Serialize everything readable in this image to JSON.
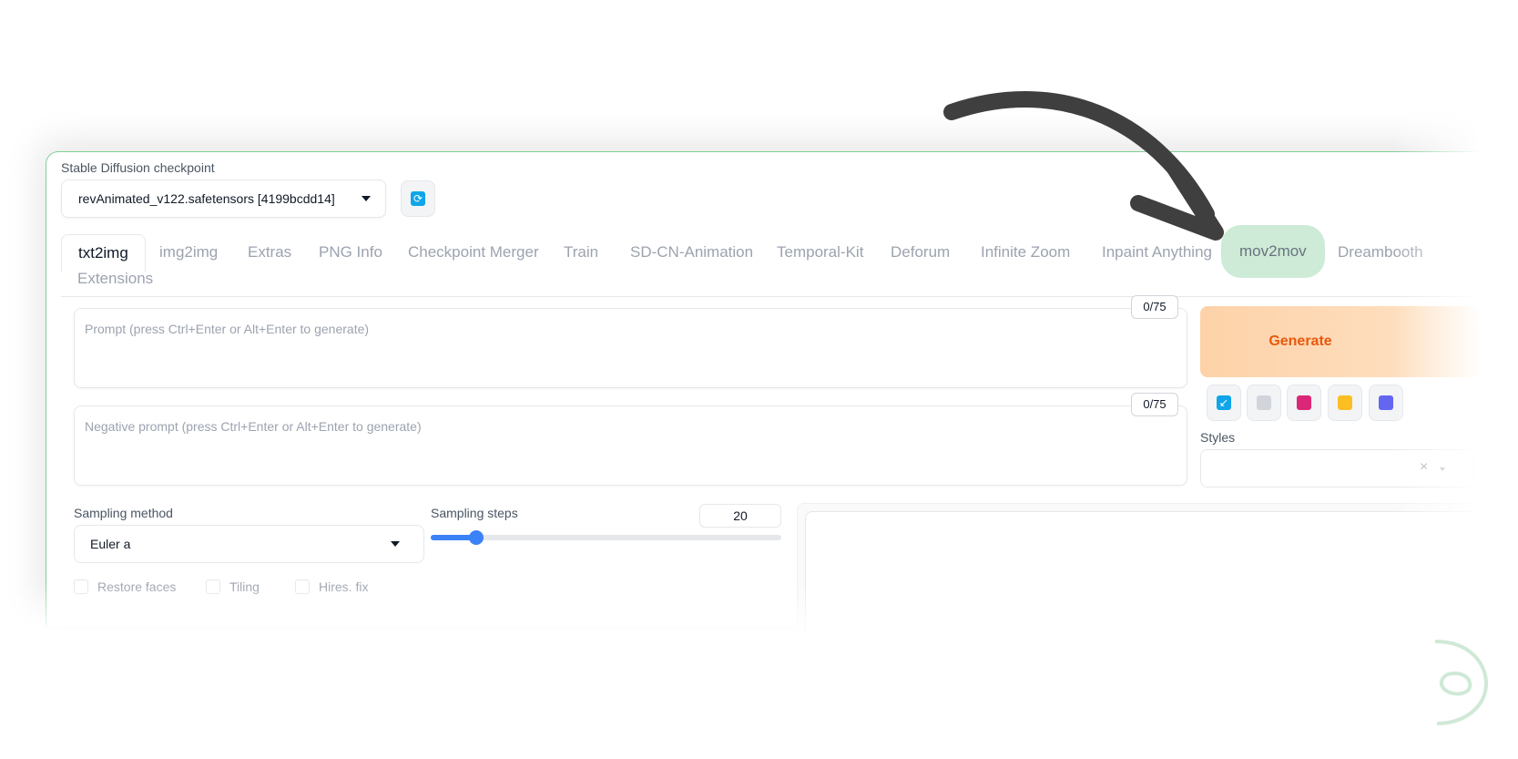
{
  "checkpoint": {
    "label": "Stable Diffusion checkpoint",
    "value": "revAnimated_v122.safetensors [4199bcdd14]",
    "refresh_icon": "refresh-icon"
  },
  "tabs": [
    {
      "label": "txt2img",
      "active": true
    },
    {
      "label": "img2img"
    },
    {
      "label": "Extras"
    },
    {
      "label": "PNG Info"
    },
    {
      "label": "Checkpoint Merger"
    },
    {
      "label": "Train"
    },
    {
      "label": "SD-CN-Animation"
    },
    {
      "label": "Temporal-Kit"
    },
    {
      "label": "Deforum"
    },
    {
      "label": "Infinite Zoom"
    },
    {
      "label": "Inpaint Anything"
    },
    {
      "label": "mov2mov",
      "highlighted": true
    },
    {
      "label": "Dreambooth"
    },
    {
      "label": "Extensions"
    }
  ],
  "prompt": {
    "placeholder": "Prompt (press Ctrl+Enter or Alt+Enter to generate)",
    "token_count": "0/75"
  },
  "negative_prompt": {
    "placeholder": "Negative prompt (press Ctrl+Enter or Alt+Enter to generate)",
    "token_count": "0/75"
  },
  "generate": {
    "label": "Generate"
  },
  "tool_buttons": [
    {
      "icon": "read-params-icon",
      "color": "#0ea5e9"
    },
    {
      "icon": "trash-icon",
      "color": "#9ca3af"
    },
    {
      "icon": "extra-networks-icon",
      "color": "#db2777"
    },
    {
      "icon": "clipboard-icon",
      "color": "#f59e0b"
    },
    {
      "icon": "save-icon",
      "color": "#6366f1"
    }
  ],
  "styles": {
    "label": "Styles",
    "clear_icon": "×"
  },
  "sampling_method": {
    "label": "Sampling method",
    "value": "Euler a"
  },
  "sampling_steps": {
    "label": "Sampling steps",
    "value": "20",
    "fraction": 0.13
  },
  "checkboxes": [
    {
      "label": "Restore faces",
      "checked": false
    },
    {
      "label": "Tiling",
      "checked": false
    },
    {
      "label": "Hires. fix",
      "checked": false
    }
  ],
  "colors": {
    "accent_green": "#7fcf95",
    "tab_highlight": "#cdebd6",
    "generate_text": "#ea580c",
    "slider": "#3b82f6"
  }
}
